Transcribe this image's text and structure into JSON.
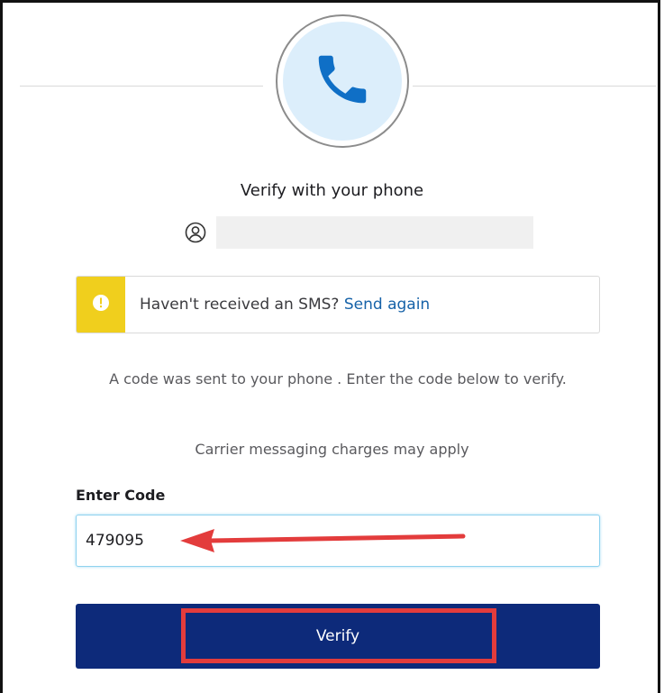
{
  "header": {
    "icon": "phone-icon",
    "title": "Verify with your phone"
  },
  "user": {
    "icon": "user-circle-icon"
  },
  "alert": {
    "icon": "warning-icon",
    "message": "Haven't received an SMS?",
    "link_label": "Send again",
    "accent_color": "#f0cf1d"
  },
  "instructions": {
    "code_sent": "A code was sent to your phone .  Enter the code below to verify.",
    "charges": "Carrier messaging charges may apply"
  },
  "form": {
    "code_label": "Enter Code",
    "code_value": "479095"
  },
  "actions": {
    "verify_label": "Verify",
    "verify_color": "#0d2a7a"
  },
  "annotations": {
    "arrow_icon": "red-arrow-icon",
    "highlight_color": "#e33c3c"
  }
}
